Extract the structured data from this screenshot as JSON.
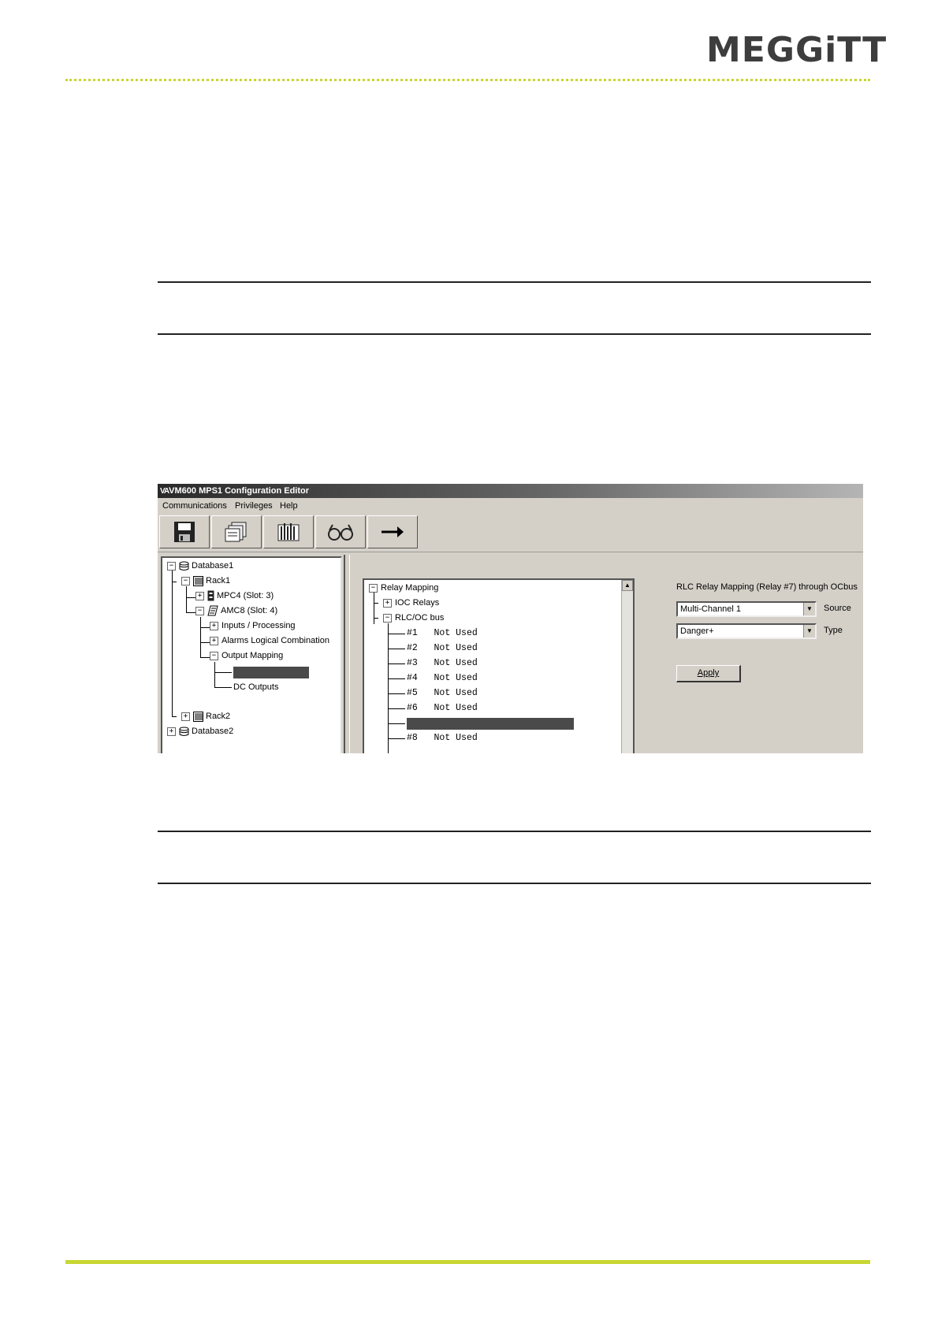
{
  "header": {
    "logo": "MEGGiTT"
  },
  "window": {
    "title": "VM600 MPS1 Configuration Editor",
    "menu": [
      "Communications",
      "Privileges",
      "Help"
    ],
    "toolbar": [
      "save-icon",
      "copy-icon",
      "rack-icon",
      "glasses-icon",
      "arrow-right-icon"
    ]
  },
  "tree": {
    "database1": "Database1",
    "rack1": "Rack1",
    "mpc4": "MPC4 (Slot:  3)",
    "amc8": "AMC8 (Slot:  4)",
    "inputs": "Inputs / Processing",
    "alarms": "Alarms Logical Combination",
    "output_mapping": "Output Mapping",
    "dc_outputs": "DC Outputs",
    "rack2": "Rack2",
    "database2": "Database2"
  },
  "relay_tree": {
    "root": "Relay Mapping",
    "ioc": "IOC Relays",
    "rlc": "RLC/OC bus",
    "items": [
      {
        "num": "#1",
        "status": "Not Used"
      },
      {
        "num": "#2",
        "status": "Not Used"
      },
      {
        "num": "#3",
        "status": "Not Used"
      },
      {
        "num": "#4",
        "status": "Not Used"
      },
      {
        "num": "#5",
        "status": "Not Used"
      },
      {
        "num": "#6",
        "status": "Not Used"
      }
    ],
    "item8": {
      "num": "#8",
      "status": "Not Used"
    }
  },
  "config": {
    "heading": "RLC Relay Mapping (Relay #7) through OCbus",
    "source_value": "Multi-Channel 1",
    "source_label": "Source",
    "type_value": "Danger+",
    "type_label": "Type",
    "apply": "Apply"
  },
  "colors": {
    "accent": "#c8d632",
    "highlight": "#4a4a4a"
  }
}
